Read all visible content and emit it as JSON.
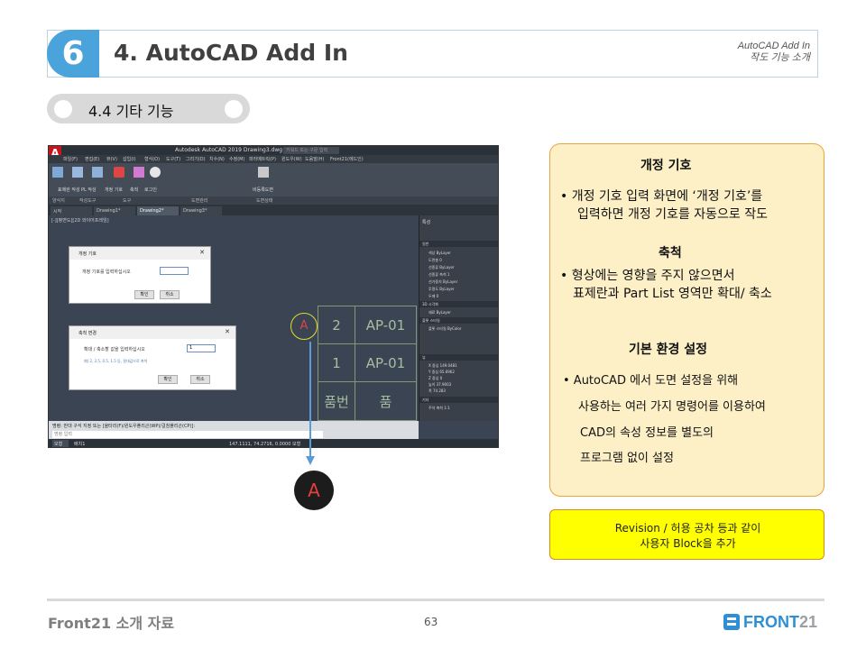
{
  "header": {
    "number": "6",
    "title": "4. AutoCAD Add In",
    "subtitle_line1": "AutoCAD Add In",
    "subtitle_line2": "작도 기능 소개"
  },
  "section_pill": {
    "label": "4.4 기타 기능"
  },
  "screenshot": {
    "app_logo": "A",
    "window_title": "Autodesk AutoCAD 2019    Drawing3.dwg",
    "search_placeholder": "키워드 또는 구문 입력",
    "menu": [
      "파일(F)",
      "편집(E)",
      "뷰(V)",
      "삽입(I)",
      "형식(O)",
      "도구(T)",
      "그리기(D)",
      "치수(N)",
      "수정(M)",
      "파라메트릭(P)",
      "윈도우(W)",
      "도움말(H)",
      "Front21(에드인)"
    ],
    "ribbon_labels": [
      "표제란 작성",
      "PL 작성",
      "개정 기호",
      "축척",
      "로그인",
      "비등록도면"
    ],
    "ribbon_tabs": [
      "양식지",
      "작성도구",
      "도구",
      "도면관리",
      "도면상태"
    ],
    "doc_tabs": [
      "시작",
      "Drawing1*",
      "Drawing2*",
      "Drawing3*"
    ],
    "canvas_label": "[-][평면도][2D 와이어프레임]",
    "table_cells": [
      "2",
      "AP-01",
      "1",
      "AP-01",
      "품번",
      "품"
    ],
    "rev_mark": "A",
    "props_title": "특성",
    "props_rows": [
      "일반",
      "색상  ByLayer",
      "도면층  0",
      "선종류  ByLayer",
      "선종류 축척  1",
      "선가중치  ByLayer",
      "투명도  ByLayer",
      "두께  0",
      "3D 시각화",
      "재료  ByLayer",
      "플롯 스타일",
      "플롯 스타일  ByColor",
      "뷰",
      "X 중심  149.0481",
      "Y 중심  65.6962",
      "Z 중심  0",
      "높이  37.9003",
      "폭  74.283",
      "기타",
      "주석 축척  1:1"
    ],
    "dialog1": {
      "title": "개정 기호",
      "prompt": "개정 기호를 입력하십시오",
      "ok": "확인",
      "cancel": "취소"
    },
    "dialog2": {
      "title": "축척 변경",
      "prompt": "확대 / 축소할 값을 입력하십시오",
      "value": "1",
      "hint": "예) 2, 2.5, 0.5, 1.5 등, 절대값으로 축척",
      "ok": "확인",
      "cancel": "취소"
    },
    "cmd_text": "명령: 반대 구석 지정 또는 [울타리(F)/윈도우폴리곤(WP)/걸침폴리곤(CP)]:",
    "cmd_placeholder": "명령 입력",
    "status_tabs": [
      "모형",
      "배치1"
    ],
    "status_coords": "147.1111, 74.2716, 0.0000  모형"
  },
  "callout": {
    "label": "A"
  },
  "info": {
    "h1": "개정 기호",
    "t1a": "•  개정 기호 입력 화면에 ‘개정 기호’를",
    "t1b": "입력하면 개정 기호를 자동으로 작도",
    "h2": "축척",
    "t2a": "•  형상에는 영향을 주지 않으면서",
    "t2b": "표제란과 Part List 영역만 확대/ 축소",
    "h3": "기본 환경 설정",
    "t3a": "•  AutoCAD 에서 도면 설정을 위해",
    "t3b": "사용하는 여러 가지 명령어를 이용하여",
    "t3c": "CAD의 속성 정보를 별도의",
    "t3d": "프로그램 없이 설정"
  },
  "note": {
    "line1": "Revision / 허용 공차 등과 같이",
    "line2": "사용자 Block을 추가"
  },
  "footer": {
    "left": "Front21 소개 자료",
    "page": "63",
    "logo_a": "FRONT",
    "logo_b": "21"
  },
  "colors": {
    "accent": "#4ba3dc",
    "box": "#fdefc6",
    "note": "#ffff00"
  }
}
